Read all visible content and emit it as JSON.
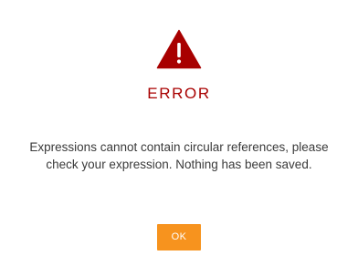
{
  "dialog": {
    "title": "ERROR",
    "message": "Expressions cannot contain circular references, please check your expression. Nothing has been saved.",
    "ok_label": "OK",
    "icon": "warning-icon"
  },
  "colors": {
    "title": "#a80000",
    "icon": "#a80000",
    "button": "#f7931e",
    "button_text": "#ffffff",
    "message": "#3a3a3a"
  }
}
